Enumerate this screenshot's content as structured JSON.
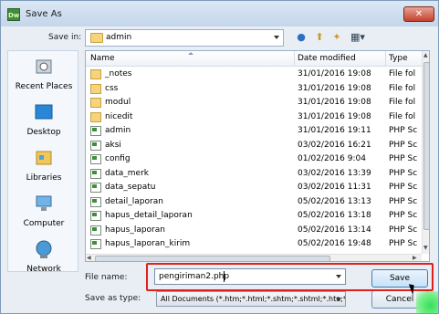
{
  "window": {
    "title": "Save As",
    "app_icon_text": "Dw",
    "close_label": "✕"
  },
  "toolbar": {
    "save_in_label": "Save in:",
    "save_in_value": "admin",
    "back_icon": "back-icon",
    "up_icon": "up-folder-icon",
    "new_folder_icon": "new-folder-icon",
    "view_icon": "view-menu-icon"
  },
  "places": [
    {
      "label": "Recent Places",
      "icon": "recent-places-icon"
    },
    {
      "label": "Desktop",
      "icon": "desktop-icon"
    },
    {
      "label": "Libraries",
      "icon": "libraries-icon"
    },
    {
      "label": "Computer",
      "icon": "computer-icon"
    },
    {
      "label": "Network",
      "icon": "network-icon"
    }
  ],
  "columns": {
    "name": "Name",
    "date": "Date modified",
    "type": "Type"
  },
  "files": [
    {
      "name": "_notes",
      "date": "31/01/2016 19:08",
      "type": "File fol",
      "kind": "folder"
    },
    {
      "name": "css",
      "date": "31/01/2016 19:08",
      "type": "File fol",
      "kind": "folder"
    },
    {
      "name": "modul",
      "date": "31/01/2016 19:08",
      "type": "File fol",
      "kind": "folder"
    },
    {
      "name": "nicedit",
      "date": "31/01/2016 19:08",
      "type": "File fol",
      "kind": "folder"
    },
    {
      "name": "admin",
      "date": "31/01/2016 19:11",
      "type": "PHP Sc",
      "kind": "php"
    },
    {
      "name": "aksi",
      "date": "03/02/2016 16:21",
      "type": "PHP Sc",
      "kind": "php"
    },
    {
      "name": "config",
      "date": "01/02/2016 9:04",
      "type": "PHP Sc",
      "kind": "php"
    },
    {
      "name": "data_merk",
      "date": "03/02/2016 13:39",
      "type": "PHP Sc",
      "kind": "php"
    },
    {
      "name": "data_sepatu",
      "date": "03/02/2016 11:31",
      "type": "PHP Sc",
      "kind": "php"
    },
    {
      "name": "detail_laporan",
      "date": "05/02/2016 13:13",
      "type": "PHP Sc",
      "kind": "php"
    },
    {
      "name": "hapus_detail_laporan",
      "date": "05/02/2016 13:18",
      "type": "PHP Sc",
      "kind": "php"
    },
    {
      "name": "hapus_laporan",
      "date": "05/02/2016 13:14",
      "type": "PHP Sc",
      "kind": "php"
    },
    {
      "name": "hapus_laporan_kirim",
      "date": "05/02/2016 19:48",
      "type": "PHP Sc",
      "kind": "php"
    }
  ],
  "form": {
    "file_name_label": "File name:",
    "file_name_value": "pengiriman2.php",
    "save_as_type_label": "Save as type:",
    "save_as_type_value": "All Documents (*.htm;*.html;*.shtm;*.shtml;*.hta;*.htc;"
  },
  "buttons": {
    "save": "Save",
    "cancel": "Cancel"
  },
  "colors": {
    "highlight": "#e0201c",
    "accent": "#6d8fbd"
  }
}
